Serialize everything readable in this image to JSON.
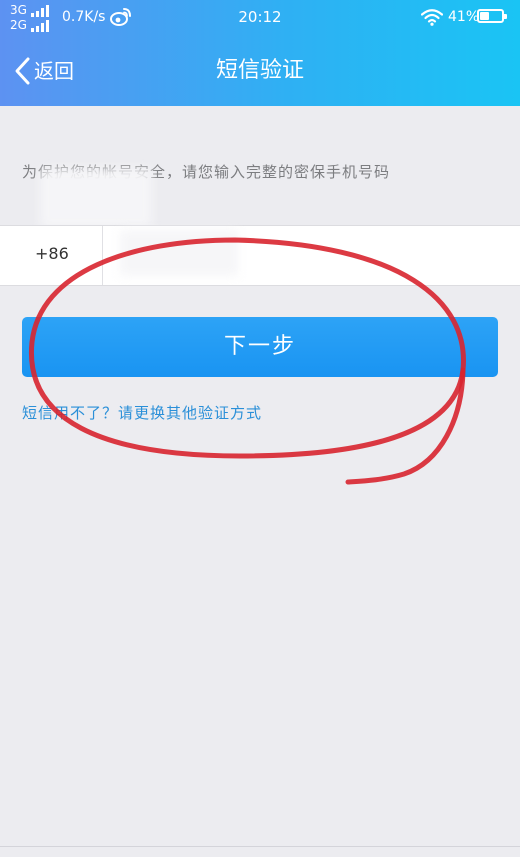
{
  "status_bar": {
    "network_top": "3G",
    "network_bottom": "2G",
    "speed": "0.7K/s",
    "time": "20:12",
    "battery": "41%",
    "battery_level": 0.41
  },
  "nav": {
    "back_label": "返回",
    "title": "短信验证"
  },
  "notice": {
    "text": "为保护您的帐号安全，请您输入完整的密保手机号码"
  },
  "phone": {
    "country_code": "+86",
    "value": ""
  },
  "next_button": {
    "label": "下一步"
  },
  "alt_link": {
    "label": "短信用不了？请更换其他验证方式"
  },
  "colors": {
    "header_start": "#5d92f2",
    "header_end": "#1ac4f4",
    "button": "#1994f2",
    "link": "#2a8fd8",
    "annotation_red": "#d8252f",
    "background": "#ececf0"
  },
  "icons": {
    "back": "chevron-left-icon",
    "weibo": "weibo-icon",
    "wifi": "wifi-icon",
    "battery": "battery-icon",
    "signal": "signal-bars-icon"
  }
}
